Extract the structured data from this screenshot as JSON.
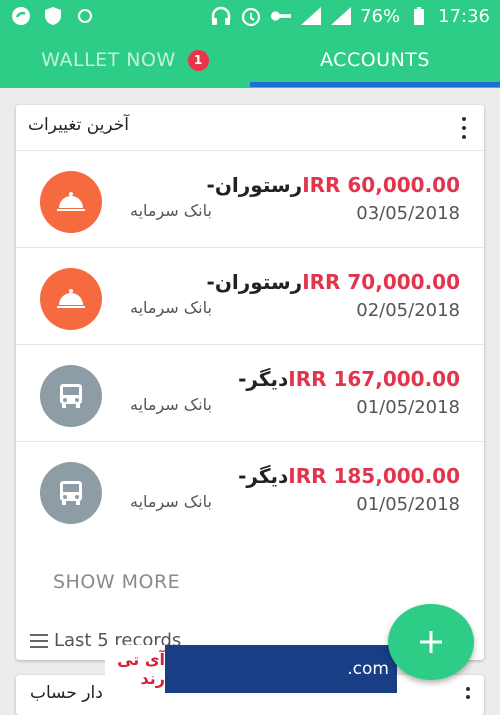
{
  "status_bar": {
    "battery": "76%",
    "time": "17:36"
  },
  "tabs": [
    {
      "label": "WALLET NOW",
      "badge": "1"
    },
    {
      "label": "ACCOUNTS"
    }
  ],
  "card": {
    "title": "آخرین تغییرات",
    "transactions": [
      {
        "amount": "IRR 60,000.00",
        "category": "-رستوران",
        "bank": "بانک سرمایه",
        "date": "03/05/2018",
        "icon": "restaurant-icon",
        "color": "#f56a3e"
      },
      {
        "amount": "IRR 70,000.00",
        "category": "-رستوران",
        "bank": "بانک سرمایه",
        "date": "02/05/2018",
        "icon": "restaurant-icon",
        "color": "#f56a3e"
      },
      {
        "amount": "IRR 167,000.00",
        "category": "-دیگر",
        "bank": "بانک سرمایه",
        "date": "01/05/2018",
        "icon": "bus-icon",
        "color": "#8e9da5"
      },
      {
        "amount": "IRR 185,000.00",
        "category": "-دیگر",
        "bank": "بانک سرمایه",
        "date": "01/05/2018",
        "icon": "bus-icon",
        "color": "#8e9da5"
      }
    ],
    "show_more": "SHOW MORE",
    "records_label": "Last 5 records"
  },
  "card2": {
    "title": "دار حساب"
  },
  "watermark": {
    "text": "آی تی رند",
    "domain": ".com"
  },
  "colors": {
    "accent": "#2dcd87",
    "amount": "#e2344d",
    "indicator": "#1f6fd1"
  }
}
